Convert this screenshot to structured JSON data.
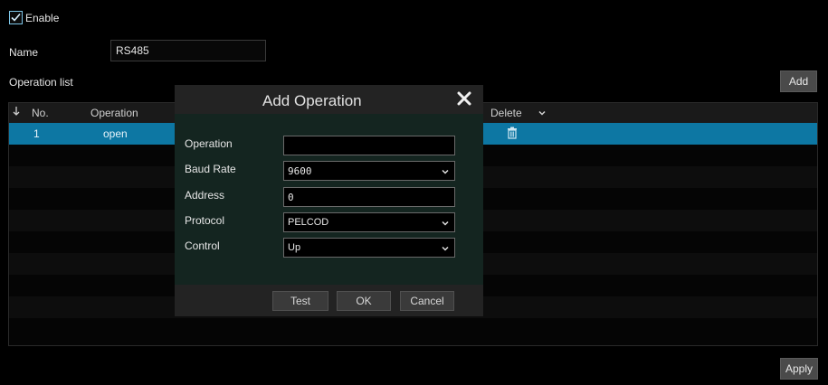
{
  "enable": {
    "label": "Enable",
    "checked": true
  },
  "name_field": {
    "label": "Name",
    "value": "RS485"
  },
  "operation_list": {
    "label": "Operation list",
    "add_label": "Add",
    "columns": {
      "sort_icon": "sort-down-icon",
      "no": "No.",
      "operation": "Operation",
      "delete": "Delete"
    },
    "rows": [
      {
        "no": "1",
        "operation": "open",
        "delete_icon": "trash-icon"
      }
    ]
  },
  "dialog": {
    "title": "Add Operation",
    "close_icon": "close-icon",
    "fields": {
      "operation": {
        "label": "Operation",
        "value": ""
      },
      "baud_rate": {
        "label": "Baud Rate",
        "value": "9600"
      },
      "address": {
        "label": "Address",
        "value": "0"
      },
      "protocol": {
        "label": "Protocol",
        "value": "PELCOD"
      },
      "control": {
        "label": "Control",
        "value": "Up"
      }
    },
    "buttons": {
      "test": "Test",
      "ok": "OK",
      "cancel": "Cancel"
    }
  },
  "apply_label": "Apply",
  "colors": {
    "selected_row": "#0d77a3",
    "background": "#000000",
    "dialog_body": "#142520"
  }
}
